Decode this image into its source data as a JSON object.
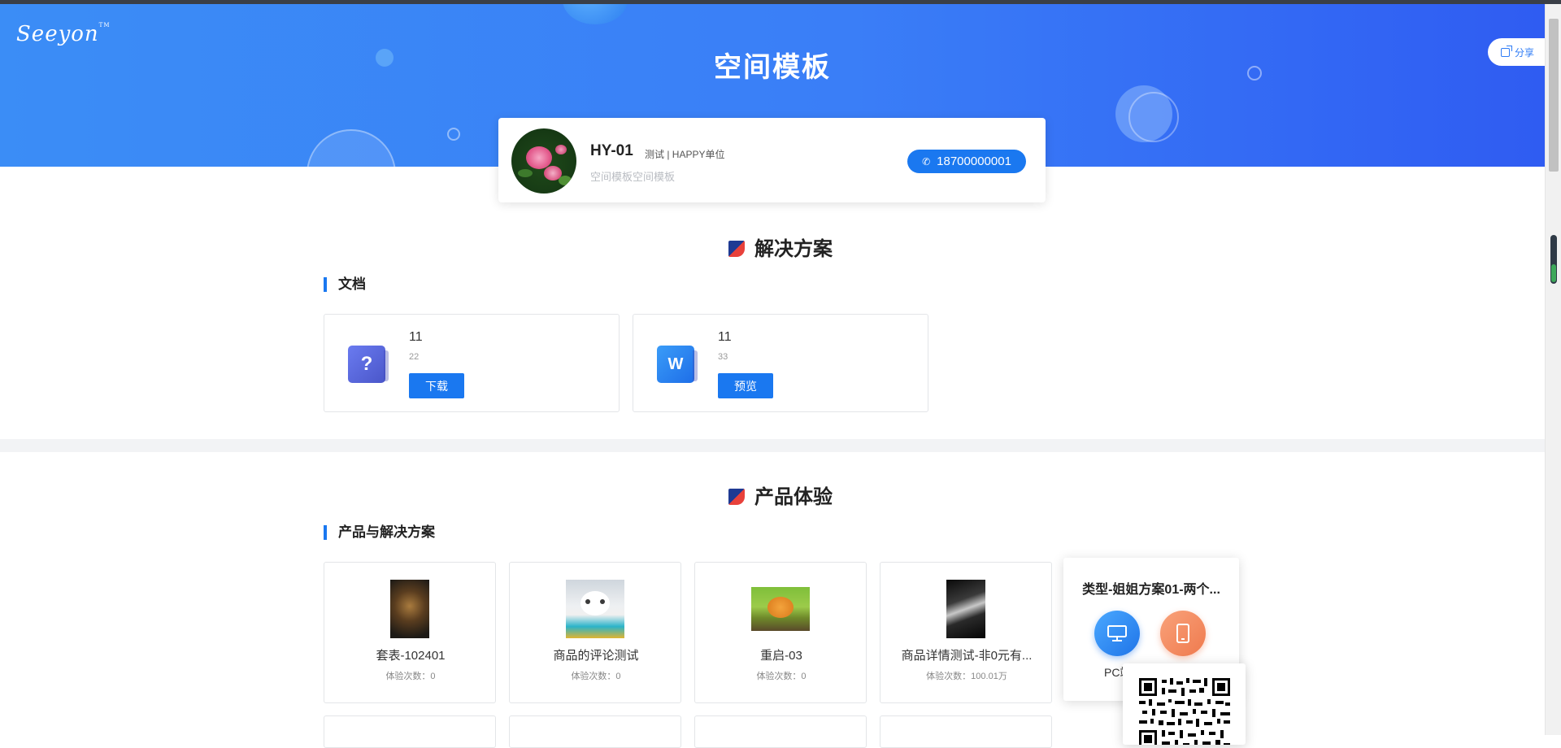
{
  "header": {
    "logo_text": "Seeyon",
    "logo_tm": "TM",
    "title": "空间模板",
    "share_label": "分享"
  },
  "profile": {
    "name": "HY-01",
    "tags": "测试 | HAPPY单位",
    "description": "空间模板空间模板",
    "phone": "18700000001"
  },
  "solutions": {
    "title": "解决方案",
    "subtitle": "文档",
    "docs": [
      {
        "title": "11",
        "sub": "22",
        "button": "下载",
        "icon": "?"
      },
      {
        "title": "11",
        "sub": "33",
        "button": "预览",
        "icon": "W"
      }
    ]
  },
  "products": {
    "title": "产品体验",
    "subtitle": "产品与解决方案",
    "items": [
      {
        "name": "套表-102401",
        "count": "体验次数：0"
      },
      {
        "name": "商品的评论测试",
        "count": "体验次数：0"
      },
      {
        "name": "重启-03",
        "count": "体验次数：0"
      },
      {
        "name": "商品详情测试-非0元有...",
        "count": "体验次数：100.01万"
      }
    ],
    "popup": {
      "title": "类型-姐姐方案01-两个...",
      "pc_label": "PC端"
    }
  },
  "colors": {
    "accent": "#1a78f0",
    "banner_start": "#3b8df6",
    "banner_end": "#2f5cf2"
  }
}
